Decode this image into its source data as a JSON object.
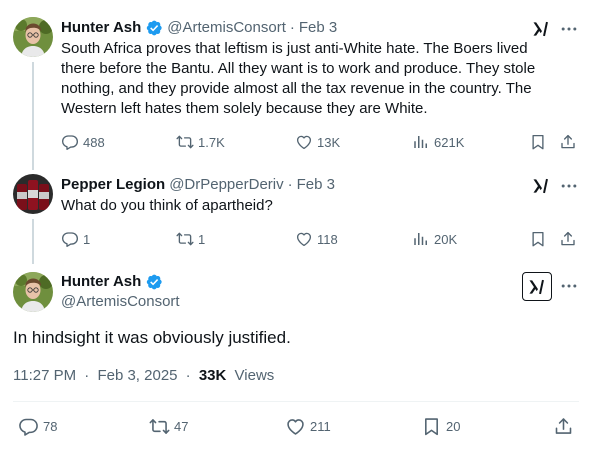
{
  "tweets": [
    {
      "name": "Hunter Ash",
      "handle": "@ArtemisConsort",
      "separator": "·",
      "date": "Feb 3",
      "lines": [
        "South Africa proves that leftism is just anti-White hate. The Boers lived",
        "there before the Bantu. All they want is to work and produce. They stole",
        "nothing, and they provide almost all the tax revenue in the country. The",
        "Western left hates them solely because they are White."
      ],
      "replies": "488",
      "reposts": "1.7K",
      "likes": "13K",
      "views": "621K"
    },
    {
      "name": "Pepper Legion",
      "handle": "@DrPepperDeriv",
      "separator": "·",
      "date": "Feb 3",
      "lines": [
        "What do you think of apartheid?"
      ],
      "replies": "1",
      "reposts": "1",
      "likes": "118",
      "views": "20K"
    }
  ],
  "main": {
    "name": "Hunter Ash",
    "handle": "@ArtemisConsort",
    "text": "In hindsight it was obviously justified.",
    "time": "11:27 PM",
    "separator": "·",
    "date": "Feb 3, 2025",
    "views_count": "33K",
    "views_label": "Views",
    "replies": "78",
    "reposts": "47",
    "likes": "211",
    "bookmarks": "20"
  },
  "colors": {
    "verified": "#1d9bf0",
    "secondary_text": "#536471",
    "primary_text": "#0f1419",
    "divider": "#eff3f4"
  },
  "icons": [
    "verified-badge-icon",
    "grok-icon",
    "more-icon",
    "reply-icon",
    "repost-icon",
    "like-icon",
    "views-icon",
    "bookmark-icon",
    "share-icon"
  ]
}
